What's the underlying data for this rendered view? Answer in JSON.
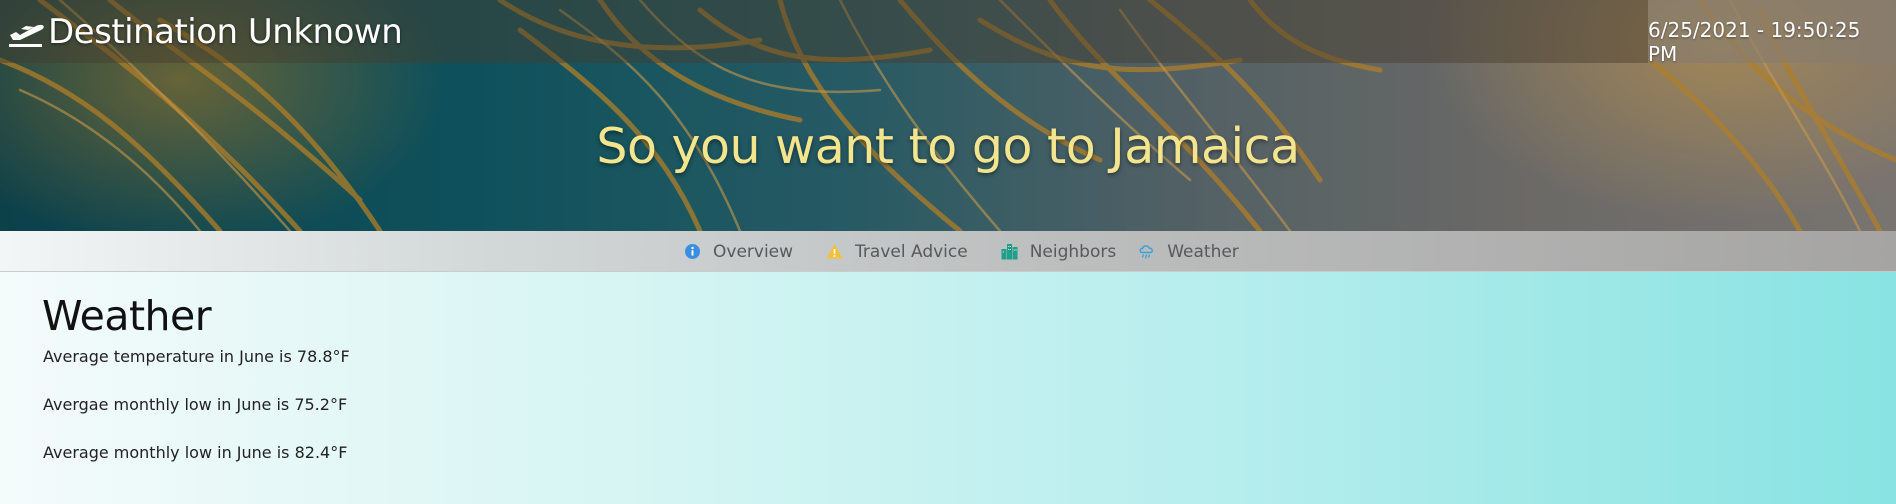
{
  "header": {
    "brand_icon": "plane-departure-icon",
    "brand_title": "Destination Unknown",
    "clock": "6/25/2021 - 19:50:25 PM"
  },
  "hero": {
    "title": "So you want to go to Jamaica",
    "title_color": "#f3e58e"
  },
  "nav": {
    "items": [
      {
        "label": "Overview",
        "icon": "info-circle-icon",
        "icon_color": "#3a8ee0"
      },
      {
        "label": "Travel Advice",
        "icon": "warning-triangle-icon",
        "icon_color": "#f2c23d"
      },
      {
        "label": "Neighbors",
        "icon": "city-buildings-icon",
        "icon_color": "#1f9e8a"
      },
      {
        "label": "Weather",
        "icon": "cloud-rain-icon",
        "icon_color": "#3aa0d9"
      }
    ]
  },
  "main": {
    "section_title": "Weather",
    "stats": [
      "Average temperature in June is 78.8°F",
      "Avergae monthly low in June is 75.2°F",
      "Average monthly low in June is 82.4°F"
    ]
  }
}
